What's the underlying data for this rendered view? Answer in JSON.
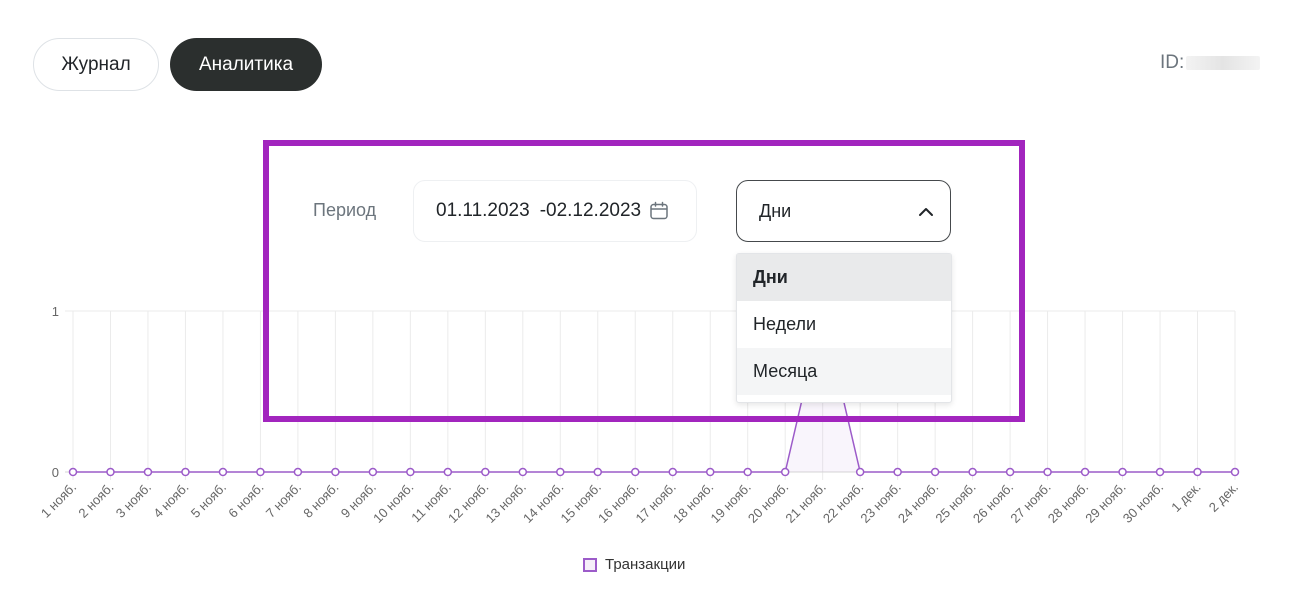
{
  "tabs": [
    {
      "label": "Журнал",
      "active": false
    },
    {
      "label": "Аналитика",
      "active": true
    }
  ],
  "id_label": "ID:",
  "filters": {
    "period_label": "Период",
    "date_from": "01.11.2023",
    "date_to": "-02.12.2023",
    "granularity_selected": "Дни",
    "granularity_options": [
      "Дни",
      "Недели",
      "Месяца"
    ]
  },
  "colors": {
    "accent": "#2b2f2e",
    "series": "#9c5bc9",
    "highlight": "#a225be"
  },
  "chart_data": {
    "type": "line",
    "categories": [
      "1 нояб.",
      "2 нояб.",
      "3 нояб.",
      "4 нояб.",
      "5 нояб.",
      "6 нояб.",
      "7 нояб.",
      "8 нояб.",
      "9 нояб.",
      "10 нояб.",
      "11 нояб.",
      "12 нояб.",
      "13 нояб.",
      "14 нояб.",
      "15 нояб.",
      "16 нояб.",
      "17 нояб.",
      "18 нояб.",
      "19 нояб.",
      "20 нояб.",
      "21 нояб.",
      "22 нояб.",
      "23 нояб.",
      "24 нояб.",
      "25 нояб.",
      "26 нояб.",
      "27 нояб.",
      "28 нояб.",
      "29 нояб.",
      "30 нояб.",
      "1 дек.",
      "2 дек."
    ],
    "series": [
      {
        "name": "Транзакции",
        "values": [
          0,
          0,
          0,
          0,
          0,
          0,
          0,
          0,
          0,
          0,
          0,
          0,
          0,
          0,
          0,
          0,
          0,
          0,
          0,
          0,
          1,
          0,
          0,
          0,
          0,
          0,
          0,
          0,
          0,
          0,
          0,
          0
        ]
      }
    ],
    "y_ticks": [
      "0",
      "1"
    ],
    "ylim": [
      0,
      1
    ],
    "grid": true,
    "legend_position": "bottom"
  }
}
